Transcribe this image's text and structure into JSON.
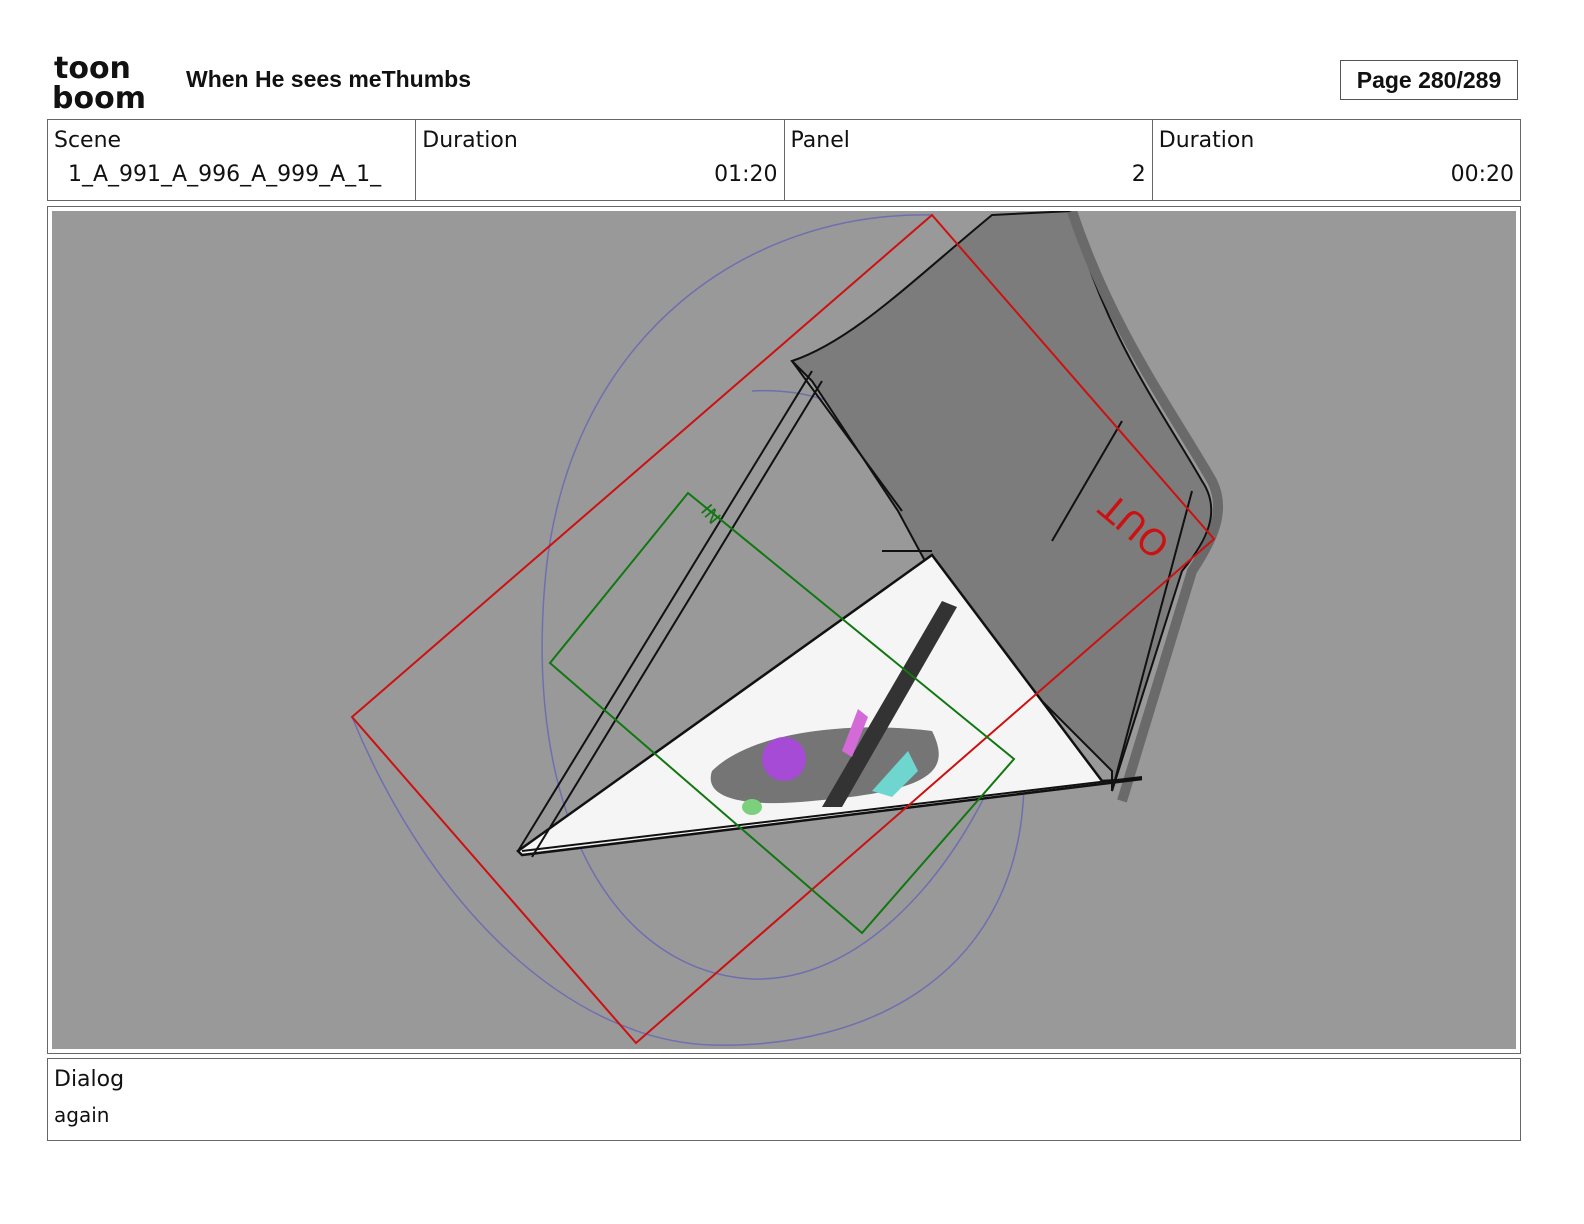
{
  "header": {
    "logo_line1": "toon",
    "logo_line2": "boom",
    "title": "When He sees meThumbs",
    "page": "Page 280/289"
  },
  "info": {
    "scene_label": "Scene",
    "scene_value": "1_A_991_A_996_A_999_A_1_",
    "scene_duration_label": "Duration",
    "scene_duration_value": "01:20",
    "panel_label": "Panel",
    "panel_value": "2",
    "panel_duration_label": "Duration",
    "panel_duration_value": "00:20"
  },
  "panel": {
    "in_label": "IN",
    "out_label": "OUT",
    "background_color": "#999999",
    "out_frame_color": "#cc1111",
    "in_frame_color": "#117711",
    "camera_path_color": "#6f6fb0"
  },
  "dialog": {
    "label": "Dialog",
    "text": "again"
  }
}
